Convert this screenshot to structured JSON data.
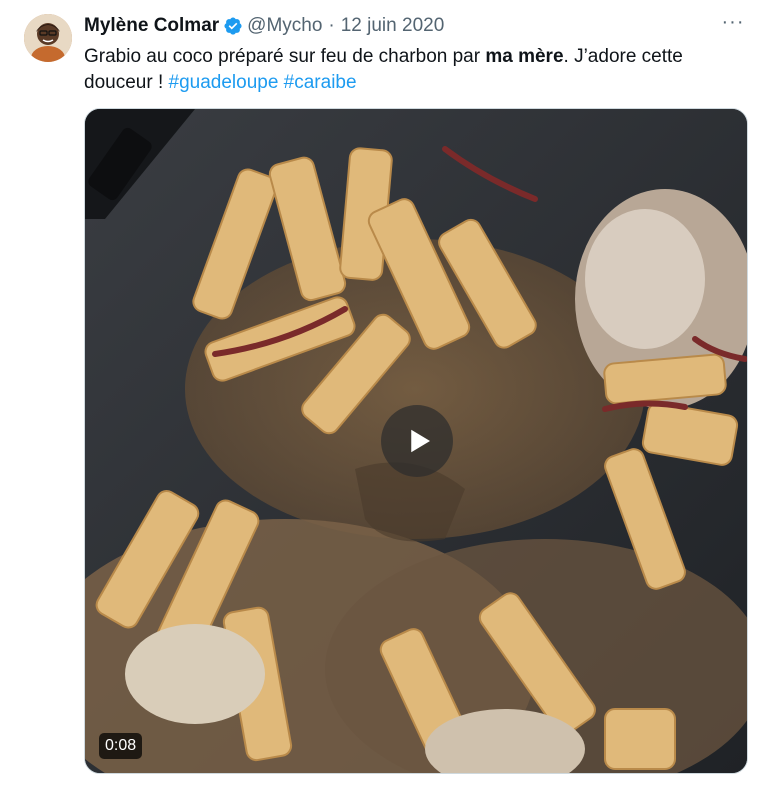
{
  "author": {
    "name": "Mylène Colmar",
    "handle": "@Mycho",
    "separator": "·",
    "date": "12 juin 2020",
    "verified": true
  },
  "tweet": {
    "text_before": "Grabio au coco préparé sur feu de charbon par ",
    "text_bold": "ma mère",
    "text_after": ". J’adore cette douceur ! ",
    "hashtags": [
      "#guadeloupe",
      "#caraibe"
    ]
  },
  "media": {
    "type": "video",
    "duration": "0:08",
    "play_icon": "play-icon"
  },
  "menu": {
    "more_label": "···"
  },
  "colors": {
    "accent": "#1d9bf0",
    "text": "#0f1419",
    "secondary": "#536471"
  }
}
